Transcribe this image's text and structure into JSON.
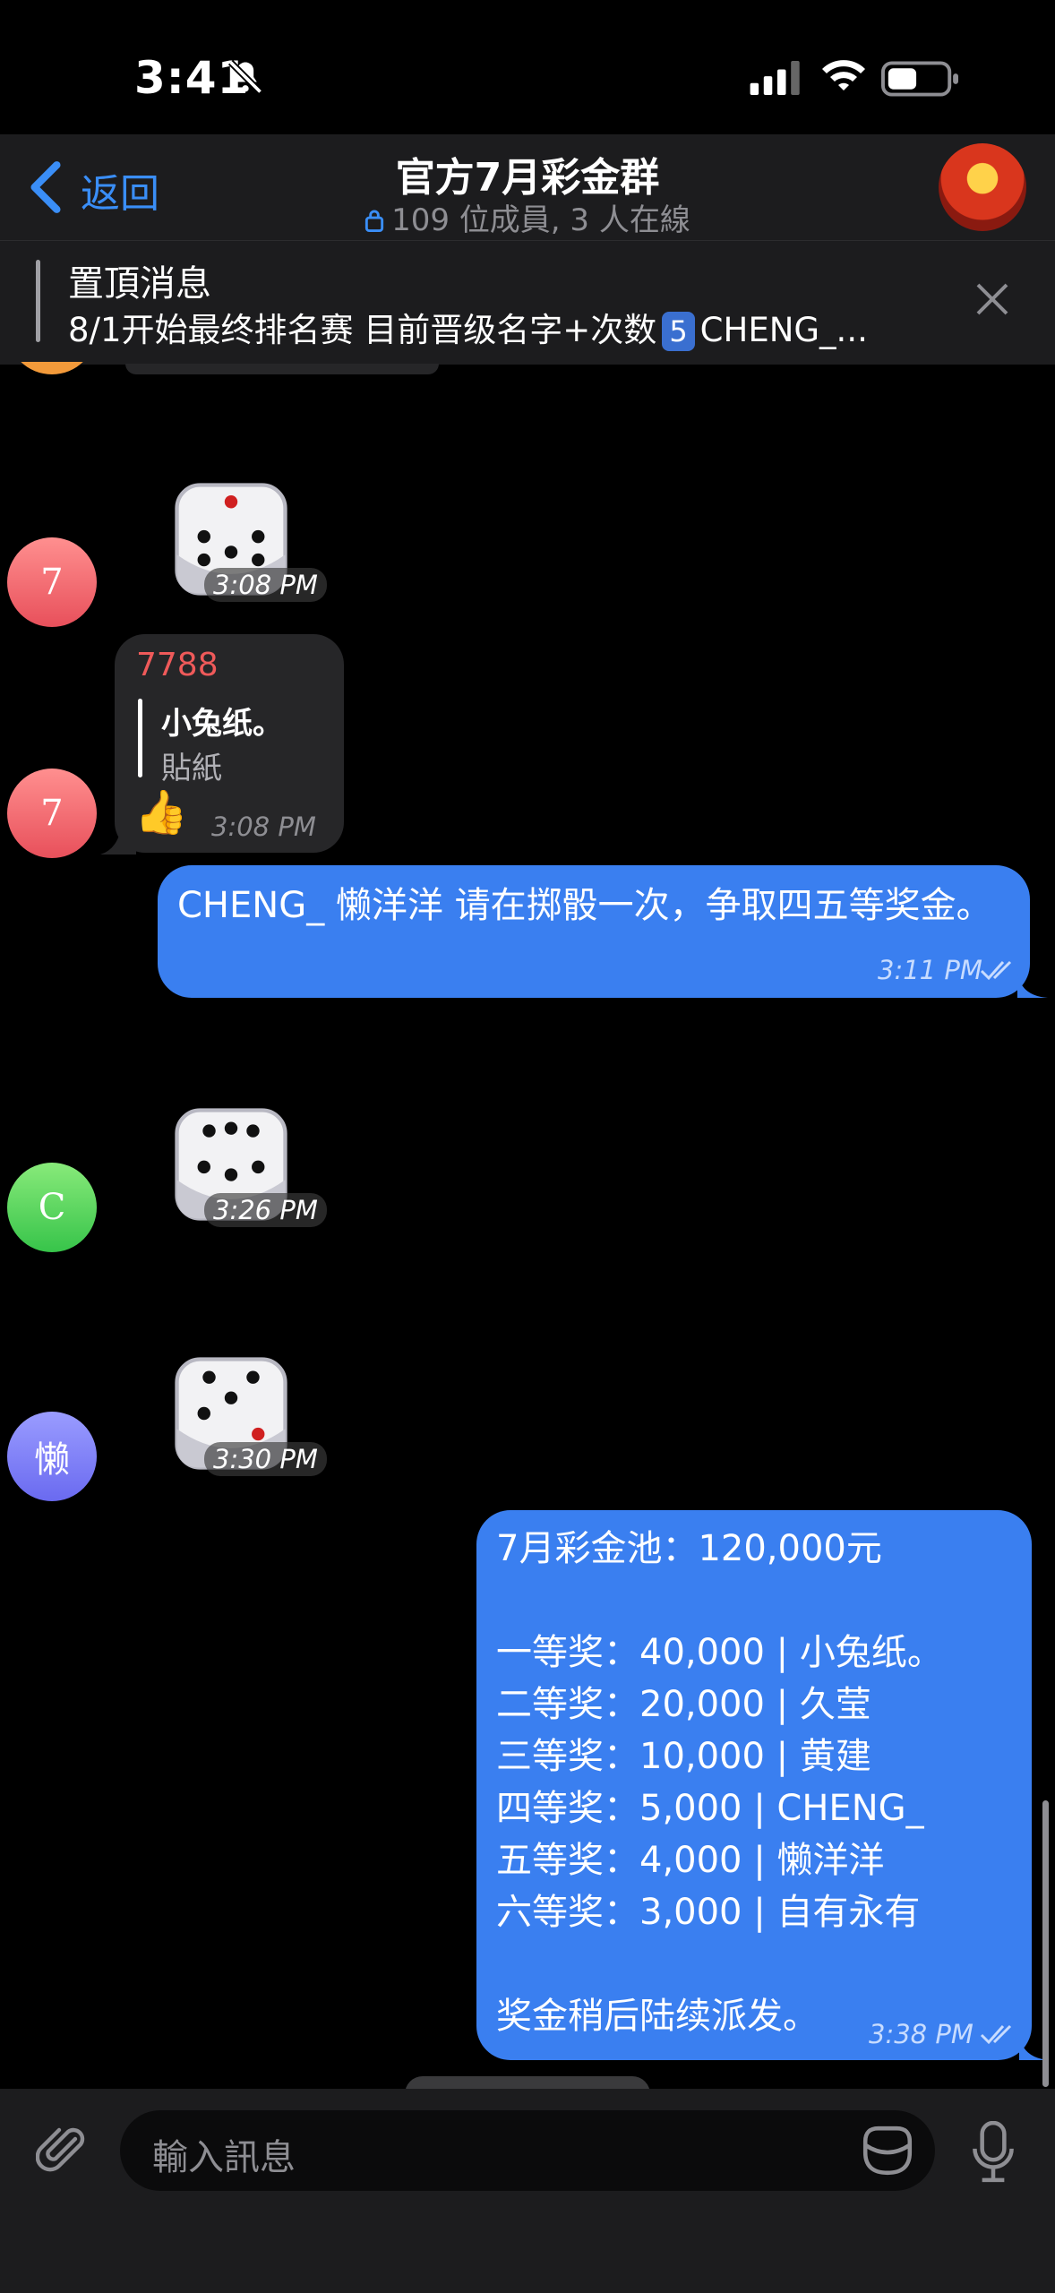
{
  "status_bar": {
    "time": "3:41"
  },
  "header": {
    "back_label": "返回",
    "title": "官方7月彩金群",
    "subtitle": "109 位成員, 3 人在線"
  },
  "pinned": {
    "title": "置頂消息",
    "text_before": "8/1开始最终排名赛 目前晋级名字+次数",
    "keycap": "5",
    "text_after": "CHENG_..."
  },
  "messages": {
    "dice1": {
      "avatar": "7",
      "time": "3:08 PM"
    },
    "reply_msg": {
      "avatar": "7",
      "sender": "7788",
      "reply_title": "小兔纸。",
      "reply_sub": "貼紙",
      "emoji": "👍",
      "time": "3:08 PM"
    },
    "out1": {
      "text": "CHENG_ 懒洋洋 请在掷骰一次，争取四五等奖金。",
      "time": "3:11 PM"
    },
    "dice2": {
      "avatar": "C",
      "time": "3:26 PM"
    },
    "dice3": {
      "avatar": "懒",
      "time": "3:30 PM"
    },
    "out2": {
      "lines": [
        "7月彩金池：120,000元",
        "",
        "一等奖：40,000 | 小兔纸。",
        "二等奖：20,000 | 久莹",
        "三等奖：10,000 | 黄建",
        "四等奖：5,000 | CHENG_",
        "五等奖：4,000 | 懒洋洋",
        "六等奖：3,000 | 自有永有",
        "",
        "奖金稍后陆续派发。"
      ],
      "time": "3:38 PM"
    }
  },
  "input": {
    "placeholder": "輸入訊息"
  },
  "icons": {
    "back": "chevron-left-icon",
    "mute": "bell-slash-icon",
    "attach": "paperclip-icon",
    "sticker": "sticker-icon",
    "mic": "microphone-icon",
    "close": "close-icon"
  },
  "colors": {
    "accent": "#3a8ef7",
    "outgoing_bubble": "#3a7ff0",
    "sender_name": "#ef5a5a"
  }
}
